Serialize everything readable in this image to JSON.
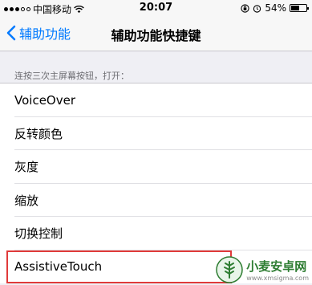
{
  "status": {
    "carrier": "中国移动",
    "time": "20:07",
    "battery": "54%",
    "battery_level": 0.54
  },
  "nav": {
    "back_label": "辅助功能",
    "title": "辅助功能快捷键"
  },
  "section": {
    "header": "连按三次主屏幕按钮，打开："
  },
  "items": [
    {
      "label": "VoiceOver"
    },
    {
      "label": "反转颜色"
    },
    {
      "label": "灰度"
    },
    {
      "label": "缩放"
    },
    {
      "label": "切换控制"
    },
    {
      "label": "AssistiveTouch"
    }
  ],
  "watermark": {
    "name": "小麦安卓网",
    "url": "www.xmsigma.com"
  },
  "colors": {
    "accent": "#007aff",
    "highlight": "#e03a3a",
    "watermark": "#2e7d32"
  }
}
